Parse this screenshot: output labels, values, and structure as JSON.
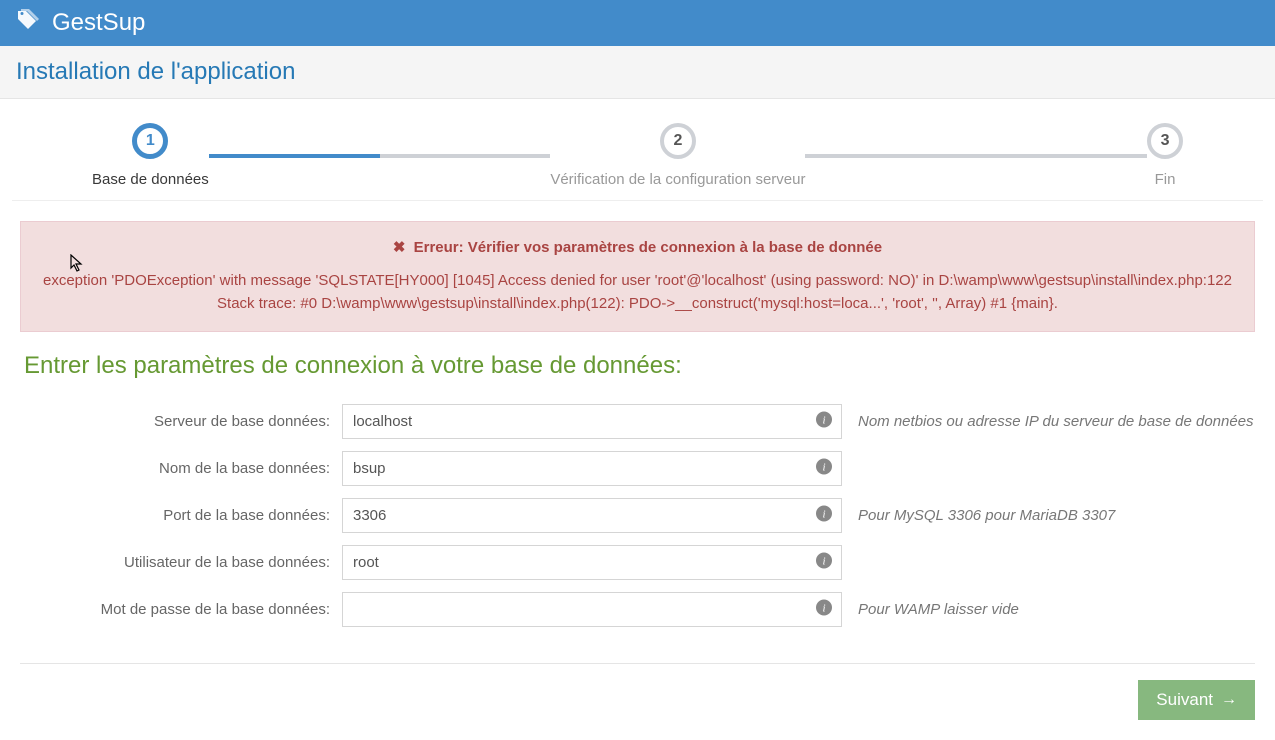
{
  "header": {
    "title": "GestSup"
  },
  "subheader": {
    "title": "Installation de l'application"
  },
  "wizard": {
    "steps": [
      {
        "num": "1",
        "label": "Base de données"
      },
      {
        "num": "2",
        "label": "Vérification de la configuration serveur"
      },
      {
        "num": "3",
        "label": "Fin"
      }
    ]
  },
  "alert": {
    "title": "Erreur: Vérifier vos paramètres de connexion à la base de donnée",
    "trace": "exception 'PDOException' with message 'SQLSTATE[HY000] [1045] Access denied for user 'root'@'localhost' (using password: NO)' in D:\\wamp\\www\\gestsup\\install\\index.php:122 Stack trace: #0 D:\\wamp\\www\\gestsup\\install\\index.php(122): PDO->__construct('mysql:host=loca...', 'root', '', Array) #1 {main}."
  },
  "section_title": "Entrer les paramètres de connexion à votre base de données:",
  "fields": {
    "server": {
      "label": "Serveur de base données:",
      "value": "localhost",
      "hint": "Nom netbios ou adresse IP du serveur de base de données"
    },
    "dbname": {
      "label": "Nom de la base données:",
      "value": "bsup",
      "hint": ""
    },
    "port": {
      "label": "Port de la base données:",
      "value": "3306",
      "hint": "Pour MySQL 3306 pour MariaDB 3307"
    },
    "user": {
      "label": "Utilisateur de la base données:",
      "value": "root",
      "hint": ""
    },
    "password": {
      "label": "Mot de passe de la base données:",
      "value": "",
      "hint": "Pour WAMP laisser vide"
    }
  },
  "next_button": "Suivant"
}
